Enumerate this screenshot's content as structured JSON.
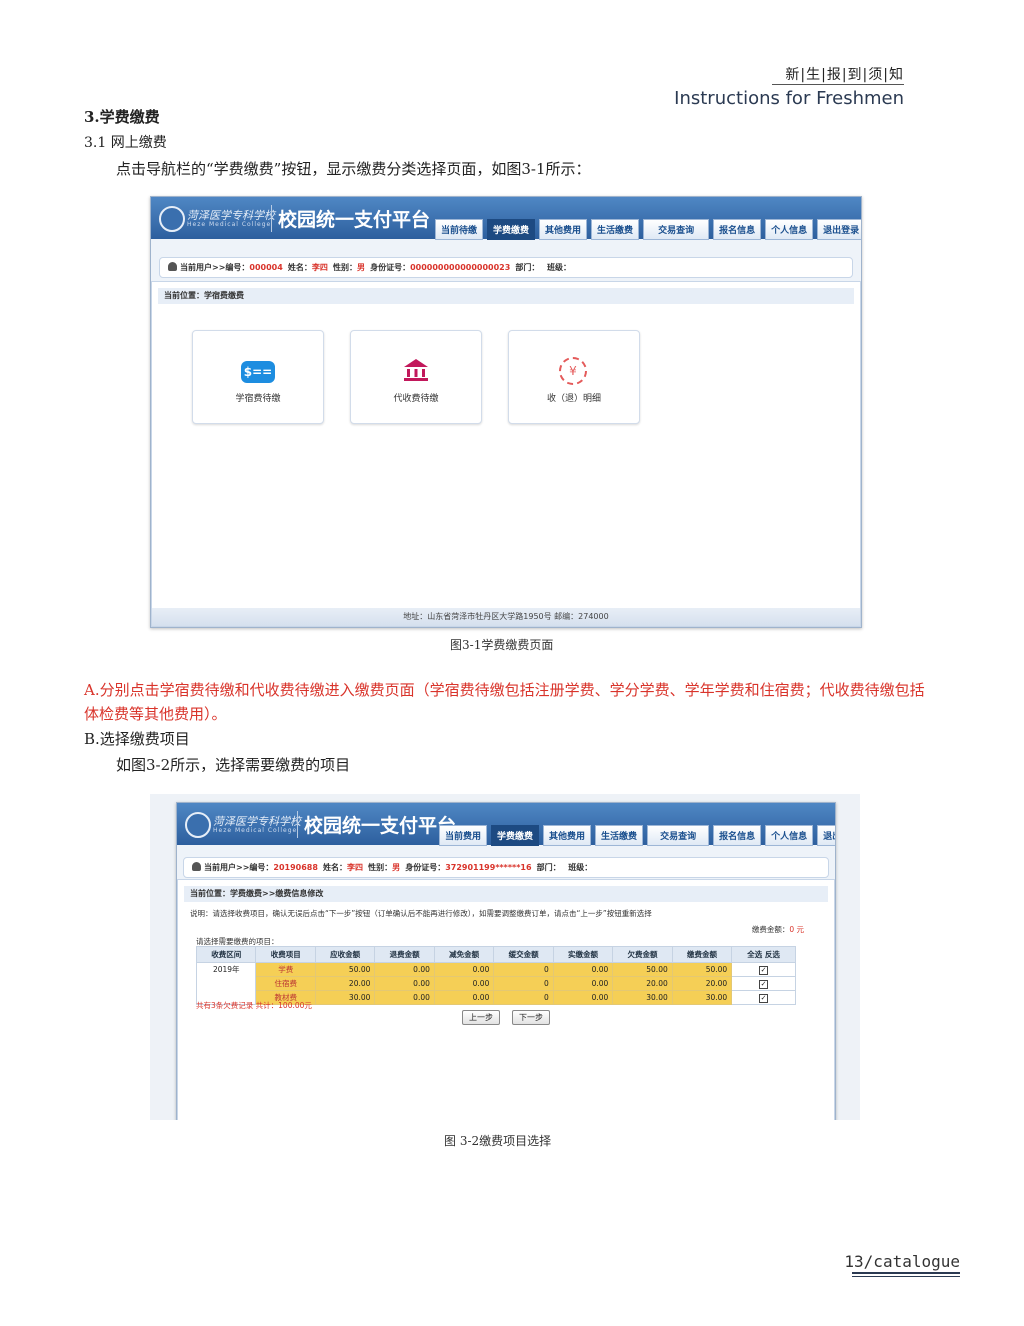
{
  "header": {
    "title_cn": "新|生|报|到|须|知",
    "title_en": "Instructions for Freshmen"
  },
  "section": {
    "heading": "3.学费缴费",
    "subheading": "3.1 网上缴费",
    "intro": "点击导航栏的“学费缴费”按钮，显示缴费分类选择页面，如图3-1所示："
  },
  "portal": {
    "school_name": "菏泽医学专科学校",
    "school_en": "Heze Medical College",
    "system_title": "校园统一支付平台",
    "footer": "地址：山东省菏泽市牡丹区大学路1950号 邮编：274000"
  },
  "figure1": {
    "nav": [
      "当前待缴",
      "学费缴费",
      "其他费用",
      "生活缴费",
      "交易查询",
      "报名信息",
      "个人信息",
      "退出登录"
    ],
    "user": {
      "prefix": "当前用户>>编号：",
      "id": "000004",
      "name_label": "姓名：",
      "name": "李四",
      "gender_label": "性别：",
      "gender": "男",
      "idcard_label": "身份证号：",
      "idcard": "000000000000000023",
      "dept_label": "部门：",
      "class_label": "班级："
    },
    "location": "当前位置：学宿费缴费",
    "cards": [
      "学宿费待缴",
      "代收费待缴",
      "收（退）明细"
    ],
    "card_icons": {
      "dollar": "$==",
      "coin": "¥"
    },
    "caption": "图3-1学费缴费页面"
  },
  "stepA": "A.分别点击学宿费待缴和代收费待缴进入缴费页面（学宿费待缴包括注册学费、学分学费、学年学费和住宿费；代收费待缴包括体检费等其他费用）。",
  "stepB": "B.选择缴费项目",
  "stepB_desc": "如图3-2所示，选择需要缴费的项目",
  "figure2": {
    "nav": [
      "当前费用",
      "学费缴费",
      "其他费用",
      "生活缴费",
      "交易查询",
      "报名信息",
      "个人信息",
      "退出登录"
    ],
    "user": {
      "prefix": "当前用户>>编号：",
      "id": "20190688",
      "name_label": "姓名：",
      "name": "李四",
      "gender_label": "性别：",
      "gender": "男",
      "idcard_label": "身份证号：",
      "idcard": "372901199******16",
      "dept_label": "部门：",
      "class_label": "班级："
    },
    "location": "当前位置：学费缴费>>缴费信息修改",
    "note": "说明：请选择收费项目，确认无误后点击“下一步”按钮（订单确认后不能再进行修改），如需要调整缴费订单，请点击“上一步”按钮重新选择",
    "total_label": "缴费金额：",
    "total_value": "0 元",
    "select_label": "请选择需要缴费的项目：",
    "columns": [
      "收费区间",
      "收费项目",
      "应收金额",
      "退费金额",
      "减免金额",
      "缓交金额",
      "实缴金额",
      "欠费金额",
      "缴费金额",
      "全选 反选"
    ],
    "period": "2019年",
    "rows": [
      {
        "item": "学费",
        "due": "50.00",
        "refund": "0.00",
        "waiver": "0.00",
        "deferred": "0",
        "paid": "0.00",
        "owed": "50.00",
        "pay": "50.00"
      },
      {
        "item": "住宿费",
        "due": "20.00",
        "refund": "0.00",
        "waiver": "0.00",
        "deferred": "0",
        "paid": "0.00",
        "owed": "20.00",
        "pay": "20.00"
      },
      {
        "item": "教材费",
        "due": "30.00",
        "refund": "0.00",
        "waiver": "0.00",
        "deferred": "0",
        "paid": "0.00",
        "owed": "30.00",
        "pay": "30.00"
      }
    ],
    "summary": "共有3条欠费记录  共计：100.00元",
    "prev_button": "上一步",
    "next_button": "下一步",
    "caption": "图 3-2缴费项目选择"
  },
  "page_number": "13/catalogue"
}
